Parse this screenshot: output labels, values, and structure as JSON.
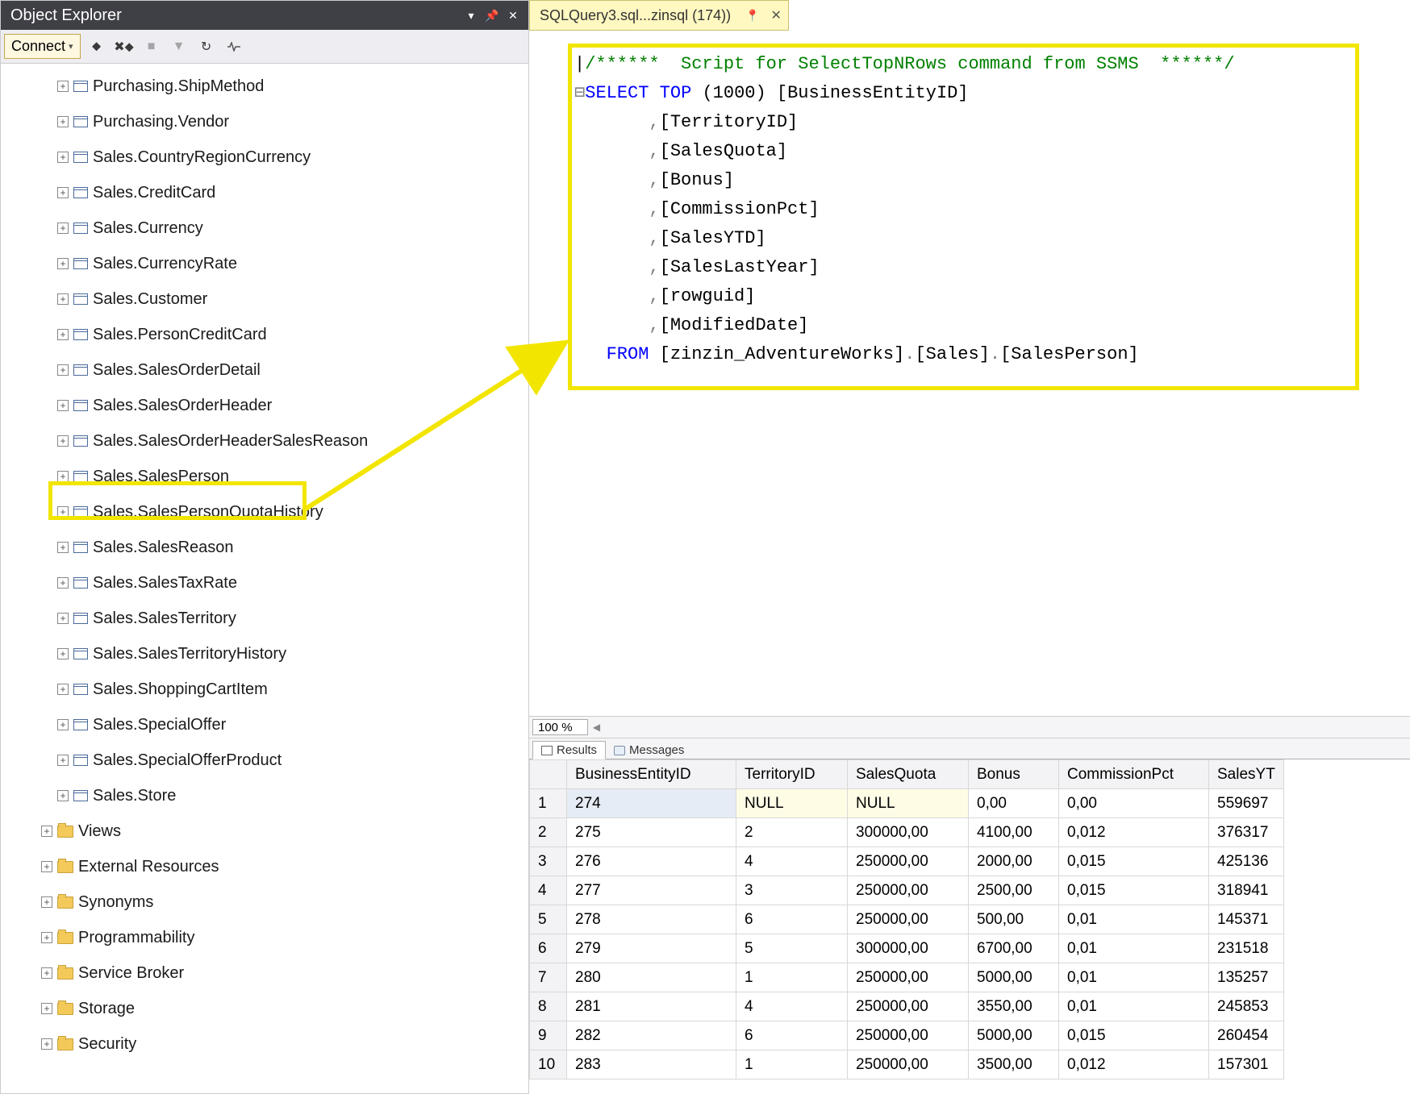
{
  "panel": {
    "title": "Object Explorer",
    "connect_label": "Connect"
  },
  "tree": {
    "tables": [
      "Purchasing.ShipMethod",
      "Purchasing.Vendor",
      "Sales.CountryRegionCurrency",
      "Sales.CreditCard",
      "Sales.Currency",
      "Sales.CurrencyRate",
      "Sales.Customer",
      "Sales.PersonCreditCard",
      "Sales.SalesOrderDetail",
      "Sales.SalesOrderHeader",
      "Sales.SalesOrderHeaderSalesReason",
      "Sales.SalesPerson",
      "Sales.SalesPersonQuotaHistory",
      "Sales.SalesReason",
      "Sales.SalesTaxRate",
      "Sales.SalesTerritory",
      "Sales.SalesTerritoryHistory",
      "Sales.ShoppingCartItem",
      "Sales.SpecialOffer",
      "Sales.SpecialOfferProduct",
      "Sales.Store"
    ],
    "folders": [
      "Views",
      "External Resources",
      "Synonyms",
      "Programmability",
      "Service Broker",
      "Storage",
      "Security"
    ]
  },
  "doc": {
    "tab_label": "SQLQuery3.sql...zinsql (174))"
  },
  "sql": {
    "comment": "/******  Script for SelectTopNRows command from SSMS  ******/",
    "select": "SELECT",
    "top": "TOP",
    "topn": "(1000)",
    "cols": [
      "[BusinessEntityID]",
      "[TerritoryID]",
      "[SalesQuota]",
      "[Bonus]",
      "[CommissionPct]",
      "[SalesYTD]",
      "[SalesLastYear]",
      "[rowguid]",
      "[ModifiedDate]"
    ],
    "from": "FROM",
    "src_db": "[zinzin_AdventureWorks]",
    "src_schema": "[Sales]",
    "src_table": "[SalesPerson]"
  },
  "zoom": {
    "value": "100 %"
  },
  "resultTabs": {
    "results": "Results",
    "messages": "Messages"
  },
  "grid": {
    "headers": [
      "BusinessEntityID",
      "TerritoryID",
      "SalesQuota",
      "Bonus",
      "CommissionPct",
      "SalesYT"
    ],
    "rows": [
      {
        "n": "1",
        "be": "274",
        "ter": "NULL",
        "sq": "NULL",
        "bon": "0,00",
        "cp": "0,00",
        "sy": "559697"
      },
      {
        "n": "2",
        "be": "275",
        "ter": "2",
        "sq": "300000,00",
        "bon": "4100,00",
        "cp": "0,012",
        "sy": "376317"
      },
      {
        "n": "3",
        "be": "276",
        "ter": "4",
        "sq": "250000,00",
        "bon": "2000,00",
        "cp": "0,015",
        "sy": "425136"
      },
      {
        "n": "4",
        "be": "277",
        "ter": "3",
        "sq": "250000,00",
        "bon": "2500,00",
        "cp": "0,015",
        "sy": "318941"
      },
      {
        "n": "5",
        "be": "278",
        "ter": "6",
        "sq": "250000,00",
        "bon": "500,00",
        "cp": "0,01",
        "sy": "145371"
      },
      {
        "n": "6",
        "be": "279",
        "ter": "5",
        "sq": "300000,00",
        "bon": "6700,00",
        "cp": "0,01",
        "sy": "231518"
      },
      {
        "n": "7",
        "be": "280",
        "ter": "1",
        "sq": "250000,00",
        "bon": "5000,00",
        "cp": "0,01",
        "sy": "135257"
      },
      {
        "n": "8",
        "be": "281",
        "ter": "4",
        "sq": "250000,00",
        "bon": "3550,00",
        "cp": "0,01",
        "sy": "245853"
      },
      {
        "n": "9",
        "be": "282",
        "ter": "6",
        "sq": "250000,00",
        "bon": "5000,00",
        "cp": "0,015",
        "sy": "260454"
      },
      {
        "n": "10",
        "be": "283",
        "ter": "1",
        "sq": "250000,00",
        "bon": "3500,00",
        "cp": "0,012",
        "sy": "157301"
      }
    ]
  }
}
